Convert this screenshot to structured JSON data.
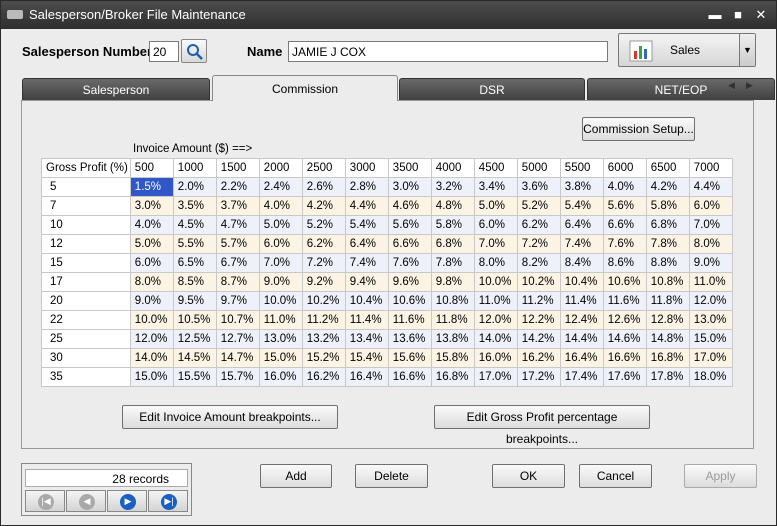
{
  "window": {
    "title": "Salesperson/Broker File Maintenance",
    "min_glyph": "▬",
    "max_glyph": "■",
    "close_glyph": "✕"
  },
  "header": {
    "salesperson_number_label": "Salesperson Number",
    "salesperson_number_value": "20",
    "name_label": "Name",
    "name_value": "JAMIE J COX",
    "sales_button_label": "Sales"
  },
  "tabs": [
    "Salesperson",
    "Commission",
    "DSR",
    "NET/EOP"
  ],
  "active_tab": "Commission",
  "commission": {
    "setup_button": "Commission Setup...",
    "invoice_amount_label": "Invoice Amount ($) ==>",
    "gross_profit_header": "Gross Profit (%)",
    "invoice_breakpoints": [
      "500",
      "1000",
      "1500",
      "2000",
      "2500",
      "3000",
      "3500",
      "4000",
      "4500",
      "5000",
      "5500",
      "6000",
      "6500",
      "7000"
    ],
    "rows": [
      {
        "gp": "5",
        "vals": [
          "1.5%",
          "2.0%",
          "2.2%",
          "2.4%",
          "2.6%",
          "2.8%",
          "3.0%",
          "3.2%",
          "3.4%",
          "3.6%",
          "3.8%",
          "4.0%",
          "4.2%",
          "4.4%"
        ]
      },
      {
        "gp": "7",
        "vals": [
          "3.0%",
          "3.5%",
          "3.7%",
          "4.0%",
          "4.2%",
          "4.4%",
          "4.6%",
          "4.8%",
          "5.0%",
          "5.2%",
          "5.4%",
          "5.6%",
          "5.8%",
          "6.0%"
        ]
      },
      {
        "gp": "10",
        "vals": [
          "4.0%",
          "4.5%",
          "4.7%",
          "5.0%",
          "5.2%",
          "5.4%",
          "5.6%",
          "5.8%",
          "6.0%",
          "6.2%",
          "6.4%",
          "6.6%",
          "6.8%",
          "7.0%"
        ]
      },
      {
        "gp": "12",
        "vals": [
          "5.0%",
          "5.5%",
          "5.7%",
          "6.0%",
          "6.2%",
          "6.4%",
          "6.6%",
          "6.8%",
          "7.0%",
          "7.2%",
          "7.4%",
          "7.6%",
          "7.8%",
          "8.0%"
        ]
      },
      {
        "gp": "15",
        "vals": [
          "6.0%",
          "6.5%",
          "6.7%",
          "7.0%",
          "7.2%",
          "7.4%",
          "7.6%",
          "7.8%",
          "8.0%",
          "8.2%",
          "8.4%",
          "8.6%",
          "8.8%",
          "9.0%"
        ]
      },
      {
        "gp": "17",
        "vals": [
          "8.0%",
          "8.5%",
          "8.7%",
          "9.0%",
          "9.2%",
          "9.4%",
          "9.6%",
          "9.8%",
          "10.0%",
          "10.2%",
          "10.4%",
          "10.6%",
          "10.8%",
          "11.0%"
        ]
      },
      {
        "gp": "20",
        "vals": [
          "9.0%",
          "9.5%",
          "9.7%",
          "10.0%",
          "10.2%",
          "10.4%",
          "10.6%",
          "10.8%",
          "11.0%",
          "11.2%",
          "11.4%",
          "11.6%",
          "11.8%",
          "12.0%"
        ]
      },
      {
        "gp": "22",
        "vals": [
          "10.0%",
          "10.5%",
          "10.7%",
          "11.0%",
          "11.2%",
          "11.4%",
          "11.6%",
          "11.8%",
          "12.0%",
          "12.2%",
          "12.4%",
          "12.6%",
          "12.8%",
          "13.0%"
        ]
      },
      {
        "gp": "25",
        "vals": [
          "12.0%",
          "12.5%",
          "12.7%",
          "13.0%",
          "13.2%",
          "13.4%",
          "13.6%",
          "13.8%",
          "14.0%",
          "14.2%",
          "14.4%",
          "14.6%",
          "14.8%",
          "15.0%"
        ]
      },
      {
        "gp": "30",
        "vals": [
          "14.0%",
          "14.5%",
          "14.7%",
          "15.0%",
          "15.2%",
          "15.4%",
          "15.6%",
          "15.8%",
          "16.0%",
          "16.2%",
          "16.4%",
          "16.6%",
          "16.8%",
          "17.0%"
        ]
      },
      {
        "gp": "35",
        "vals": [
          "15.0%",
          "15.5%",
          "15.7%",
          "16.0%",
          "16.2%",
          "16.4%",
          "16.6%",
          "16.8%",
          "17.0%",
          "17.2%",
          "17.4%",
          "17.6%",
          "17.8%",
          "18.0%"
        ]
      }
    ],
    "edit_invoice_button": "Edit Invoice Amount breakpoints...",
    "edit_gp_button": "Edit Gross Profit percentage breakpoints..."
  },
  "footer": {
    "record_count": "28 records",
    "add_button": "Add",
    "delete_button": "Delete",
    "ok_button": "OK",
    "cancel_button": "Cancel",
    "apply_button": "Apply"
  },
  "colors": {
    "selected_cell": "#2f57c8",
    "odd_row": "#eef0fa",
    "even_row": "#fbf4e4",
    "title_bar": "#3a3a3a"
  },
  "icons": [
    "app-icon",
    "search-icon",
    "chart-icon",
    "dropdown-arrow-icon",
    "tab-prev-icon",
    "tab-next-icon",
    "first-record-icon",
    "prev-record-icon",
    "next-record-icon",
    "last-record-icon"
  ]
}
